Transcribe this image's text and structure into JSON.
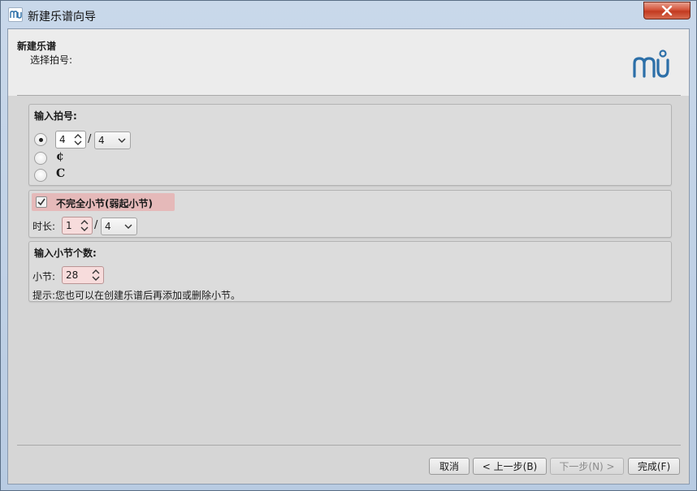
{
  "window": {
    "title": "新建乐谱向导"
  },
  "header": {
    "title": "新建乐谱",
    "subtitle": "选择拍号:"
  },
  "time_signature": {
    "group_title": "输入拍号:",
    "numerator": "4",
    "separator": "/",
    "denominator": "4",
    "options": [
      {
        "label": "4/4 custom",
        "selected": true
      },
      {
        "symbol": "¢",
        "selected": false
      },
      {
        "symbol": "C",
        "selected": false
      }
    ]
  },
  "pickup": {
    "checkbox_label": "不完全小节(弱起小节)",
    "checked": true,
    "duration_label": "时长:",
    "duration_numerator": "1",
    "separator": "/",
    "duration_denominator": "4"
  },
  "measures": {
    "group_title": "输入小节个数:",
    "count_label": "小节:",
    "count": "28",
    "hint": "提示:您也可以在创建乐谱后再添加或删除小节。"
  },
  "buttons": {
    "cancel": "取消",
    "back": "< 上一步(B)",
    "next": "下一步(N) >",
    "finish": "完成(F)"
  },
  "colors": {
    "accent_logo": "#2c6fa8",
    "highlight": "#e5b9b9"
  }
}
